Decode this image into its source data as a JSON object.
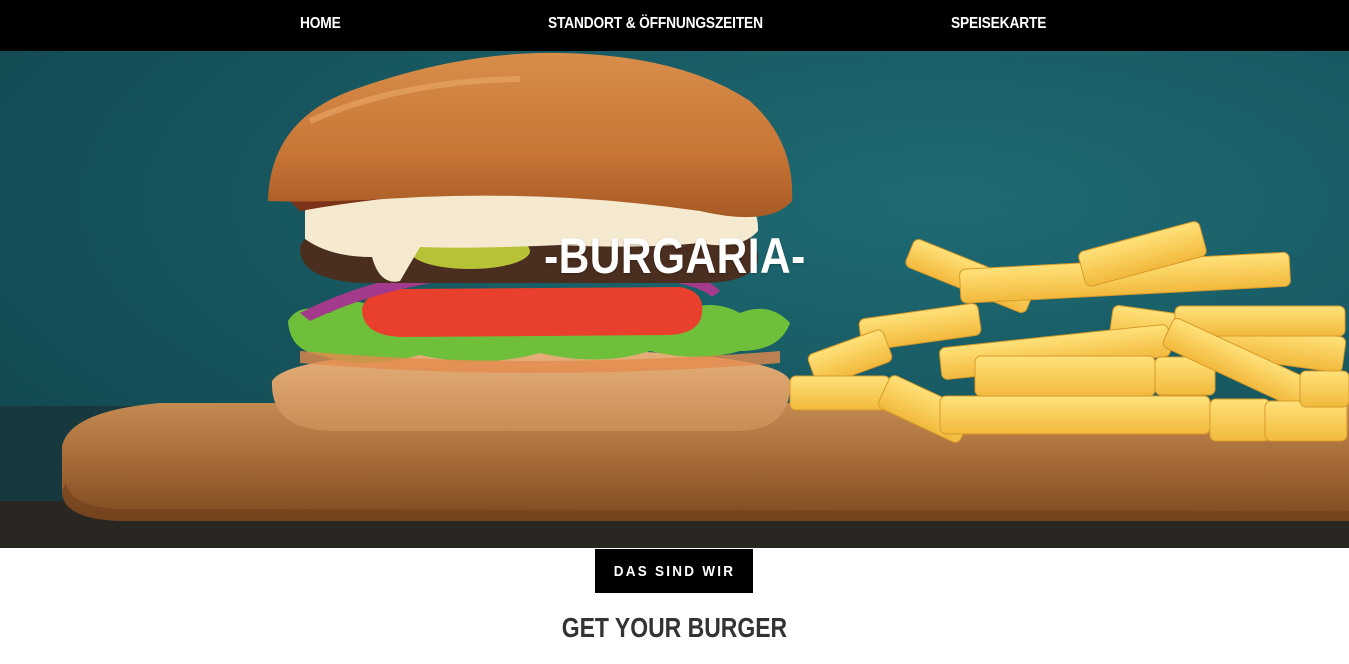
{
  "nav": {
    "home": "HOME",
    "standort": "STANDORT & ÖFFNUNGSZEITEN",
    "speisekarte": "SPEISEKARTE"
  },
  "hero": {
    "title": "-BURGARIA-"
  },
  "about": {
    "button_label": "DAS SIND WIR"
  },
  "section": {
    "title": "GET YOUR BURGER"
  },
  "colors": {
    "navbar": "#000000",
    "nav_text": "#ffffff",
    "hero_background": "#175d67",
    "button_background": "#000000",
    "section_title": "#333333"
  }
}
